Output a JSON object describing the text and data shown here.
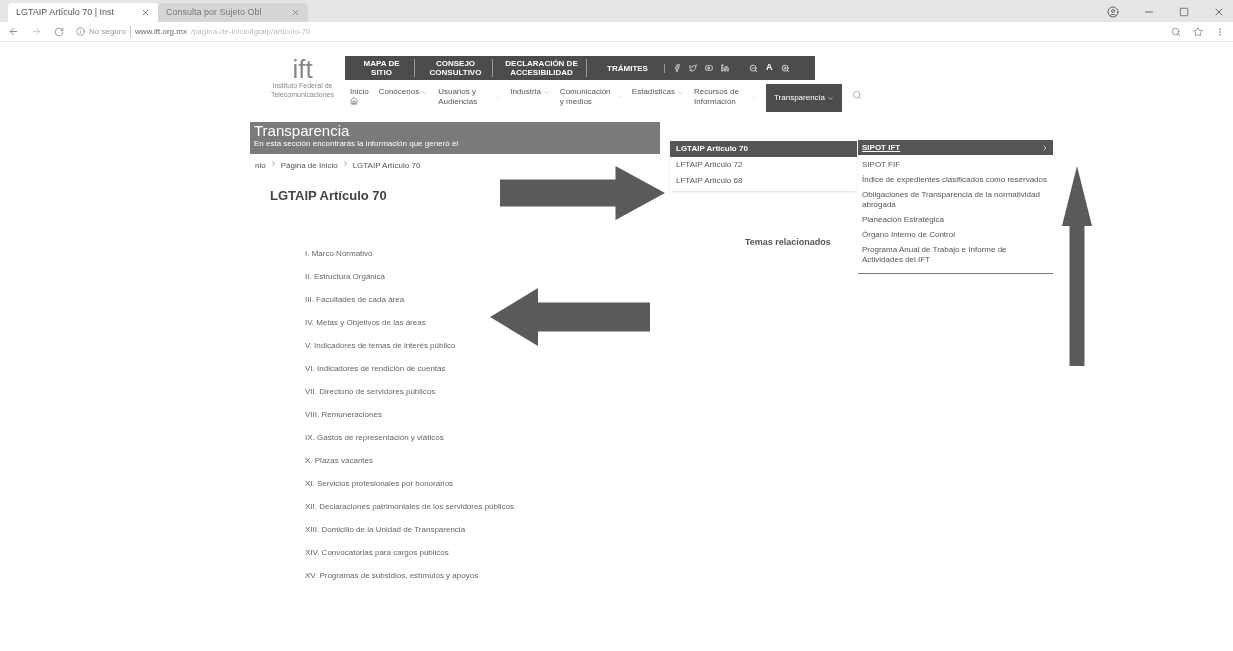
{
  "browser": {
    "tabs": [
      {
        "title": "LGTAIP Artículo 70 | Inst",
        "selected": true
      },
      {
        "title": "Consulta por Sujeto Obl",
        "selected": false
      }
    ],
    "security": "No seguro",
    "domain": "www.ift.org.mx",
    "path": "/pagina-de-inicio/lgtaip/articulo-70"
  },
  "header": {
    "logo": "ift",
    "logo_caption": "Instituto Federal de Telecomunicaciones",
    "top_links": [
      "MAPA DE SITIO",
      "CONSEJO CONSULTIVO",
      "DECLARACIÓN DE ACCESIBILIDAD",
      "TRÁMITES"
    ],
    "font_size_label": "A",
    "nav": [
      {
        "label": "Inicio",
        "kind": "home",
        "selected": false
      },
      {
        "label": "Conócenos",
        "kind": "menu",
        "selected": false
      },
      {
        "label": "Usuarios y Audiencias",
        "kind": "menu",
        "selected": false
      },
      {
        "label": "Industria",
        "kind": "menu",
        "selected": false
      },
      {
        "label": "Comunicación y medios",
        "kind": "menu",
        "selected": false
      },
      {
        "label": "Estadísticas",
        "kind": "menu",
        "selected": false
      },
      {
        "label": "Recursos de Información",
        "kind": "menu",
        "selected": false
      },
      {
        "label": "Transparencia",
        "kind": "menu",
        "selected": true
      }
    ]
  },
  "banner": {
    "title": "Transparencia",
    "subtitle": "En esta sección encontrarás la información que generó el"
  },
  "submenu": [
    {
      "label": "LGTAIP Artículo 70",
      "selected": true
    },
    {
      "label": "LFTAIP Artículo 72",
      "selected": false
    },
    {
      "label": "LFTAIP Artículo 68",
      "selected": false
    }
  ],
  "transparency_menu": [
    {
      "label": "SIPOT IFT",
      "selected": true
    },
    {
      "label": "SIPOT FIF",
      "selected": false
    },
    {
      "label": "Índice de expedientes clasificados como reservados",
      "selected": false
    },
    {
      "label": "Obligaciones de Transparencia de la normatividad abrogada",
      "selected": false
    },
    {
      "label": "Planeación Estratégica",
      "selected": false
    },
    {
      "label": "Órgano Interno de Control",
      "selected": false
    },
    {
      "label": "Programa Anual de Trabajo e Informe de Actividades del IFT",
      "selected": false
    }
  ],
  "breadcrumb": [
    "nio",
    "Página de Inicio",
    "LGTAIP Artículo 70"
  ],
  "title": "LGTAIP Artículo 70",
  "related_title": "Temas relacionados",
  "items": [
    "I. Marco Normativo",
    "II. Estructura Orgánica",
    "III. Facultades de cada área",
    "IV. Metas y Objetivos de las áreas",
    "V. Indicadores de temas de interés público",
    "VI. Indicadores de rendición de cuentas",
    "VII. Directorio de servidores públicos",
    "VIII. Remuneraciones",
    "IX. Gastos de representación y viáticos",
    "X. Plazas vacantes",
    "XI. Servicios profesionales por honorarios",
    "XII. Declaraciones patrimoniales de los servidores públicos",
    "XIII. Domicilio de la Unidad de Transparencia",
    "XIV. Convocatorias para cargos públicos",
    "XV. Programas de subsidios, estímulos y apoyos"
  ]
}
